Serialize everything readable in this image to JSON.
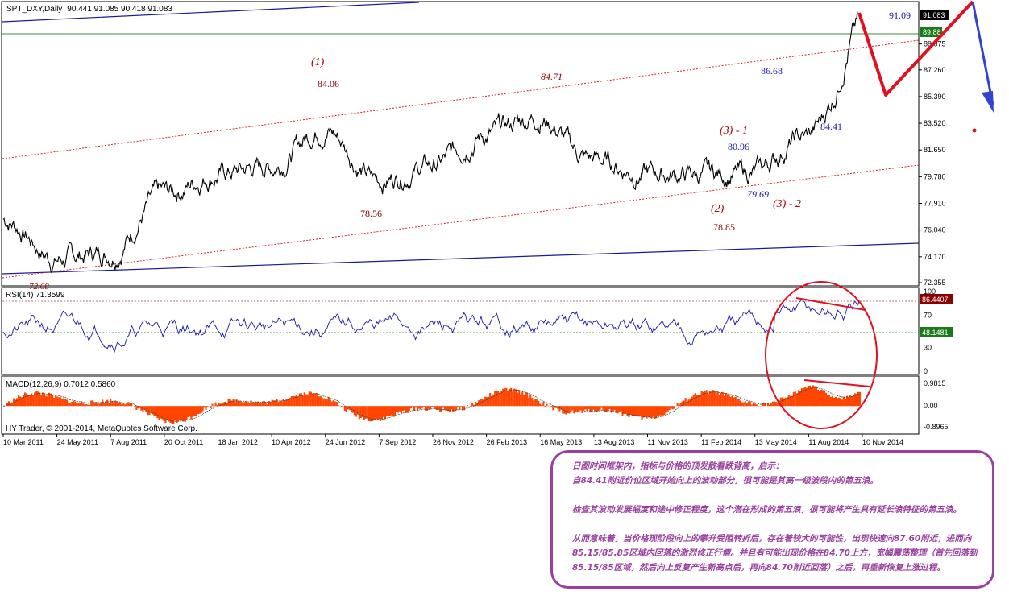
{
  "chart_data": {
    "type": "line",
    "title": "SPT_DXY,Daily",
    "ohlc_header": "90.441 91.085 90.418 91.083",
    "copyright": "HY Trader, © 2001-2014, MetaQuotes Software Corp.",
    "x_ticks": [
      "10 Mar 2011",
      "24 May 2011",
      "7 Aug 2011",
      "20 Oct 2011",
      "18 Jan 2012",
      "10 Apr 2012",
      "24 Jun 2012",
      "7 Sep 2012",
      "26 Nov 2012",
      "26 Feb 2013",
      "16 May 2013",
      "13 Aug 2013",
      "11 Nov 2013",
      "11 Feb 2014",
      "13 May 2014",
      "11 Aug 2014",
      "10 Nov 2014"
    ],
    "price": {
      "y_ticks": [
        "91.083",
        "89.88",
        "89.075",
        "87.260",
        "85.390",
        "83.520",
        "81.650",
        "79.780",
        "77.910",
        "76.040",
        "74.170",
        "72.355"
      ],
      "ylim": [
        72.355,
        91.083
      ],
      "current_price_label": "91.083",
      "level_label": "89.88",
      "series": [
        {
          "x": [
            "10 Mar 2011",
            "24 May 2011",
            "7 Aug 2011",
            "20 Oct 2011",
            "18 Jan 2012",
            "10 Apr 2012",
            "24 Jun 2012",
            "7 Sep 2012",
            "26 Nov 2012",
            "26 Feb 2013",
            "16 May 2013",
            "13 Aug 2013",
            "11 Nov 2013",
            "11 Feb 2014",
            "13 May 2014",
            "11 Aug 2014",
            "10 Nov 2014"
          ],
          "values": [
            76.8,
            74.0,
            74.5,
            78.5,
            80.0,
            80.5,
            83.2,
            79.5,
            80.5,
            82.7,
            84.0,
            81.0,
            80.0,
            79.9,
            80.0,
            82.5,
            87.5
          ]
        }
      ],
      "annotations": [
        {
          "text": "(1)",
          "kind": "wave",
          "color": "#b00000"
        },
        {
          "text": "84.06",
          "kind": "value",
          "color": "#8b0000"
        },
        {
          "text": "84.71",
          "kind": "value-italic",
          "color": "#8b0000"
        },
        {
          "text": "78.56",
          "kind": "value",
          "color": "#8b0000"
        },
        {
          "text": "(3) - 1",
          "kind": "wave",
          "color": "#b00000"
        },
        {
          "text": "80.96",
          "kind": "value",
          "color": "#1a1aaa"
        },
        {
          "text": "86.68",
          "kind": "value",
          "color": "#1a1aaa"
        },
        {
          "text": "84.41",
          "kind": "value",
          "color": "#1a1aaa"
        },
        {
          "text": "91.09",
          "kind": "value",
          "color": "#1a1aaa"
        },
        {
          "text": "79.69",
          "kind": "value-italic",
          "color": "#1a1aaa"
        },
        {
          "text": "(2)",
          "kind": "wave",
          "color": "#b00000"
        },
        {
          "text": "(3) - 2",
          "kind": "wave",
          "color": "#b00000"
        },
        {
          "text": "78.85",
          "kind": "value",
          "color": "#8b0000"
        },
        {
          "text": "72.68",
          "kind": "value-italic",
          "color": "#8b0000"
        }
      ]
    },
    "rsi": {
      "label": "RSI(14) 71.3599",
      "y_ticks": [
        "100",
        "70",
        "30",
        "0"
      ],
      "ylim": [
        0,
        100
      ],
      "current_label": "86.4407",
      "level_label": "48.1481"
    },
    "macd": {
      "label": "MACD(12,26,9) 0.7012 0.5860",
      "y_ticks": [
        "0.9815",
        "0.00",
        "-0.8965"
      ],
      "ylim": [
        -0.8965,
        0.9815
      ]
    },
    "colors": {
      "price_line": "#000000",
      "channel": "#1a1a99",
      "trend_dashed": "#cc2222",
      "rsi_line": "#1a1aaa",
      "macd_hist": "#ff4500",
      "annotation_red": "#e01020",
      "annotation_blue": "#3344cc",
      "note_border": "#9a3fa0"
    }
  },
  "note": {
    "lines": [
      "日图时间框架内，指标与价格的顶发散看跌背离，启示：",
      "自84.41附近价位区域开始向上的波动部分，很可能是其高一级波段内的第五浪。",
      "",
      "检查其波动发展幅度和途中修正程度，这个潜在形成的第五浪，很可能将产生具有延长浪特征的第五浪。",
      "",
      "从而意味着，当价格现阶段向上的攀升受阻转折后，存在着较大的可能性，出现快速向87.60附近，进而向",
      "85.15/85.85区域内回落的激烈修正行情。并且有可能出现价格在84.70上方，宽幅震荡整理（首先回落到",
      "85.15/85区域，然后向上反复产生新高点后，再向84.70附近回落）之后，再重新恢复上涨过程。"
    ]
  }
}
